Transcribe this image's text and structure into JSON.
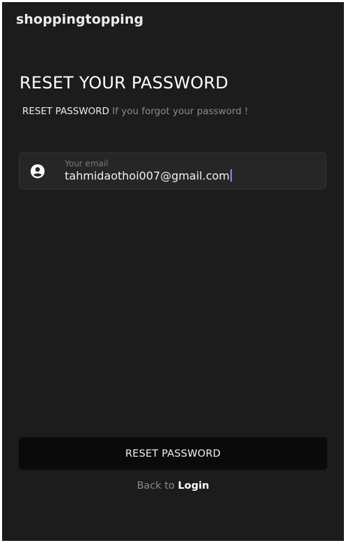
{
  "app": {
    "title": "shoppingtopping"
  },
  "page": {
    "heading": "RESET YOUR PASSWORD",
    "subtitle_strong": "RESET PASSWORD",
    "subtitle_muted": "If you forgot your password !"
  },
  "email_field": {
    "icon": "account-circle-icon",
    "label": "Your email",
    "value": "tahmidaothoi007@gmail.com",
    "caret_color": "#9b7bff"
  },
  "actions": {
    "reset_label": "RESET PASSWORD",
    "back_prefix": "Back to",
    "login_label": "Login"
  },
  "colors": {
    "background": "#1c1c1c",
    "field_background": "#262626",
    "button_background": "#0a0a0a",
    "text_primary": "#ffffff",
    "text_muted": "#8a8a8a"
  }
}
